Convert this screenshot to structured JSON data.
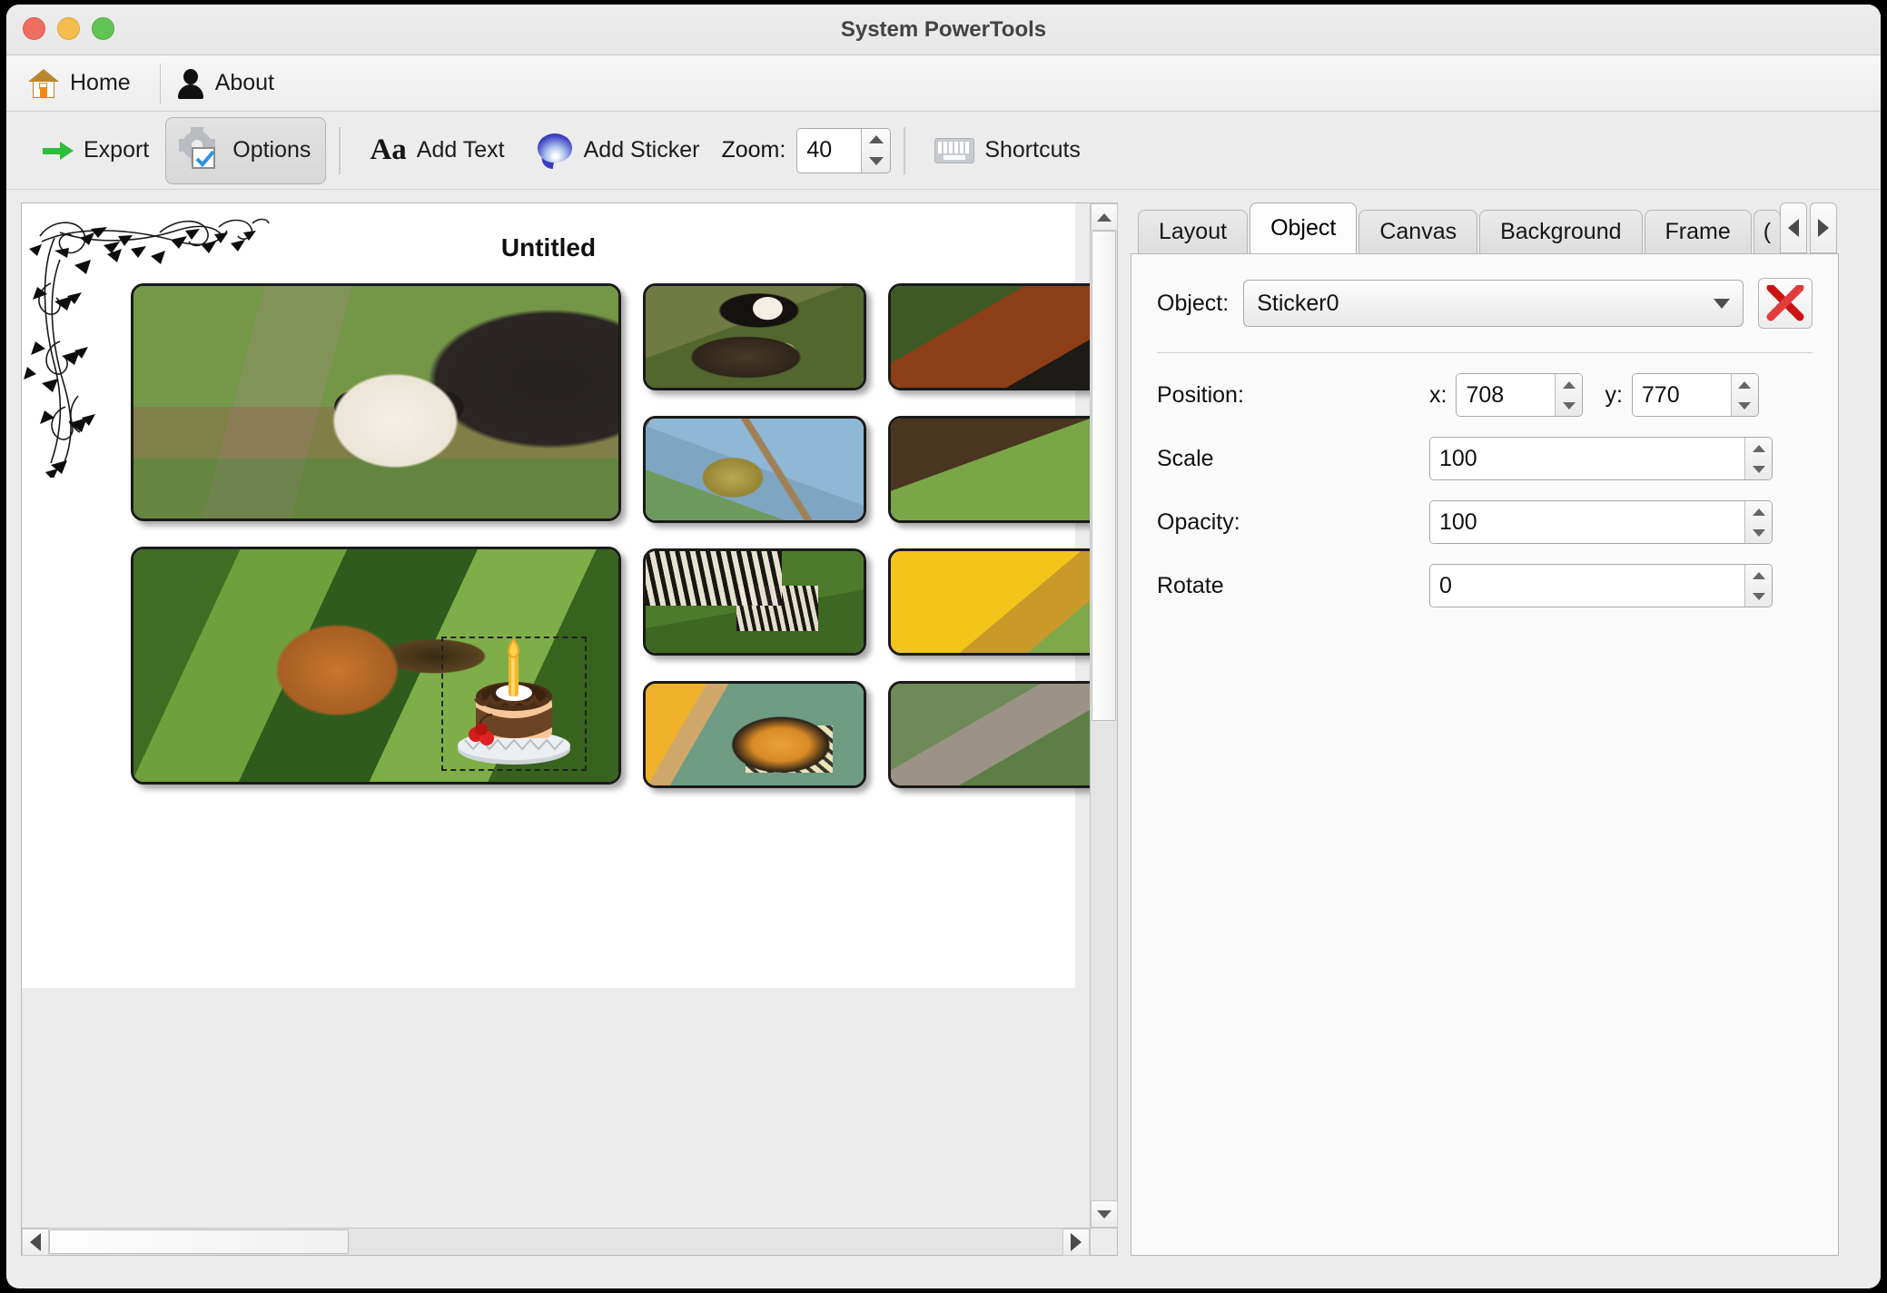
{
  "window": {
    "title": "System PowerTools",
    "traffic_lights": [
      "close-button",
      "minimize-button",
      "maximize-button"
    ]
  },
  "menubar": {
    "items": [
      {
        "label": "Home",
        "icon": "home-icon"
      },
      {
        "label": "About",
        "icon": "person-icon"
      }
    ]
  },
  "toolbar": {
    "export_label": "Export",
    "options_label": "Options",
    "add_text_label": "Add Text",
    "add_text_icon_label": "Aa",
    "add_sticker_label": "Add Sticker",
    "zoom_label": "Zoom:",
    "zoom_value": "40",
    "shortcuts_label": "Shortcuts"
  },
  "canvas": {
    "page_title": "Untitled",
    "ornament": "floral-corner-ornament",
    "photos": [
      {
        "name": "panda-photo"
      },
      {
        "name": "chipmunk-photo"
      },
      {
        "name": "goose-photo"
      },
      {
        "name": "bird-branch-photo"
      },
      {
        "name": "zebra-photo"
      },
      {
        "name": "butterfly-photo"
      },
      {
        "name": "red-panda-photo"
      },
      {
        "name": "tree-green-photo"
      },
      {
        "name": "yellow-flower-photo"
      },
      {
        "name": "branch-photo"
      }
    ],
    "sticker": {
      "name": "cake-sticker",
      "selected": true
    }
  },
  "tabs": {
    "items": [
      {
        "label": "Layout",
        "active": false
      },
      {
        "label": "Object",
        "active": true
      },
      {
        "label": "Canvas",
        "active": false
      },
      {
        "label": "Background",
        "active": false
      },
      {
        "label": "Frame",
        "active": false
      },
      {
        "label": "(",
        "active": false
      }
    ],
    "nav_prev": "◀",
    "nav_next": "▶"
  },
  "object_panel": {
    "object_label": "Object:",
    "object_value": "Sticker0",
    "delete_icon": "red-x-delete-icon",
    "position_label": "Position:",
    "x_label": "x:",
    "x_value": "708",
    "y_label": "y:",
    "y_value": "770",
    "scale_label": "Scale",
    "scale_value": "100",
    "opacity_label": "Opacity:",
    "opacity_value": "100",
    "rotate_label": "Rotate",
    "rotate_value": "0"
  },
  "colors": {
    "window_bg": "#ececec",
    "panel_bg": "#fafafa",
    "accent_green": "#2fbd3c",
    "accent_blue": "#3b3fc0",
    "delete_red": "#cc1f1f",
    "title_text": "#434343"
  }
}
